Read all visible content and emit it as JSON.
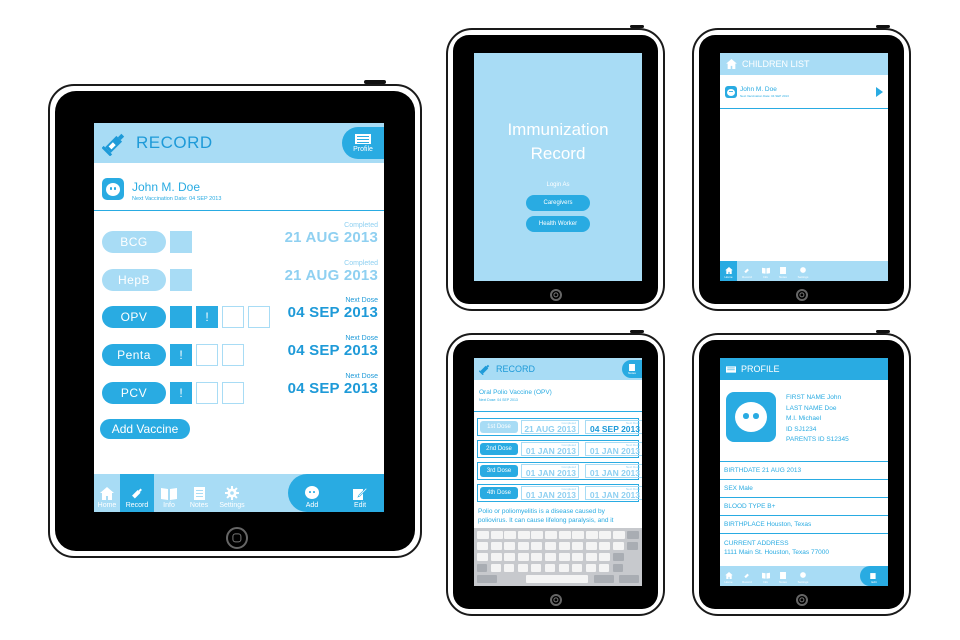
{
  "record": {
    "title": "RECORD",
    "profile_label": "Profile",
    "child_name": "John M. Doe",
    "next_vaccination": "Next Vaccination Date: 04 SEP 2013",
    "vaccines": [
      {
        "name": "BCG",
        "status": "Completed",
        "date": "21 AUG 2013"
      },
      {
        "name": "HepB",
        "status": "Completed",
        "date": "21 AUG 2013"
      },
      {
        "name": "OPV",
        "status": "Next Dose",
        "date": "04 SEP 2013"
      },
      {
        "name": "Penta",
        "status": "Next Dose",
        "date": "04 SEP 2013"
      },
      {
        "name": "PCV",
        "status": "Next Dose",
        "date": "04 SEP 2013"
      }
    ],
    "alert_mark": "!",
    "add_vaccine": "Add Vaccine",
    "tabs": {
      "home": "Home",
      "record": "Record",
      "info": "Info",
      "notes": "Notes",
      "settings": "Settings",
      "add": "Add",
      "edit": "Edit"
    }
  },
  "splash": {
    "title_line1": "Immunization",
    "title_line2": "Record",
    "login_as": "Login As",
    "caregivers": "Caregivers",
    "health_worker": "Health Worker"
  },
  "children_list": {
    "title": "CHILDREN LIST",
    "child_name": "John M. Doe",
    "next_vaccination": "Next Vaccination Date: 04 SEP 2013"
  },
  "opv_record": {
    "title": "RECORD",
    "notes_label": "Notes",
    "vaccine_name": "Oral Polio Vaccine (OPV)",
    "next_dose": "Next Dose: 04 SEP 2013",
    "doses": [
      {
        "label": "1st Dose",
        "completed_label": "Completed",
        "completed": "21 AUG 2013",
        "next_label": "Next Dose",
        "next": "04 SEP 2013"
      },
      {
        "label": "2nd Dose",
        "completed_label": "Completed",
        "completed": "01 JAN 2013",
        "next_label": "Next Dose",
        "next": "01 JAN 2013"
      },
      {
        "label": "3rd Dose",
        "completed_label": "Completed",
        "completed": "01 JAN 2013",
        "next_label": "Next Dose",
        "next": "01 JAN 2013"
      },
      {
        "label": "4th Dose",
        "completed_label": "Completed",
        "completed": "01 JAN 2013",
        "next_label": "Next Dose",
        "next": "01 JAN 2013"
      }
    ],
    "description_line1": "Polio or poliomyelitis is a disease caused by",
    "description_line2": "poliovirus. It can cause lifelong paralysis, and it"
  },
  "profile": {
    "title": "PROFILE",
    "first_name": "FIRST NAME John",
    "last_name": "LAST NAME Doe",
    "mi": "M.I. Michael",
    "id": "ID SJ1234",
    "parents_id": "PARENTS ID S12345",
    "birthdate": "BIRTHDATE 21 AUG 2013",
    "sex": "SEX Male",
    "blood": "BLOOD TYPE B+",
    "birthplace": "BIRTHPLACE Houston, Texas",
    "address_label": "CURRENT ADDRESS",
    "address": "1111 Main St. Houston, Texas 77000",
    "edit_label": "Edit"
  },
  "colors": {
    "accent": "#29abe2",
    "light": "#a8dcf5"
  },
  "icons": [
    "syringe-icon",
    "profile-card-icon",
    "home-icon",
    "book-icon",
    "notes-icon",
    "gear-icon",
    "baby-face-icon",
    "edit-icon",
    "chevron-right-icon"
  ]
}
